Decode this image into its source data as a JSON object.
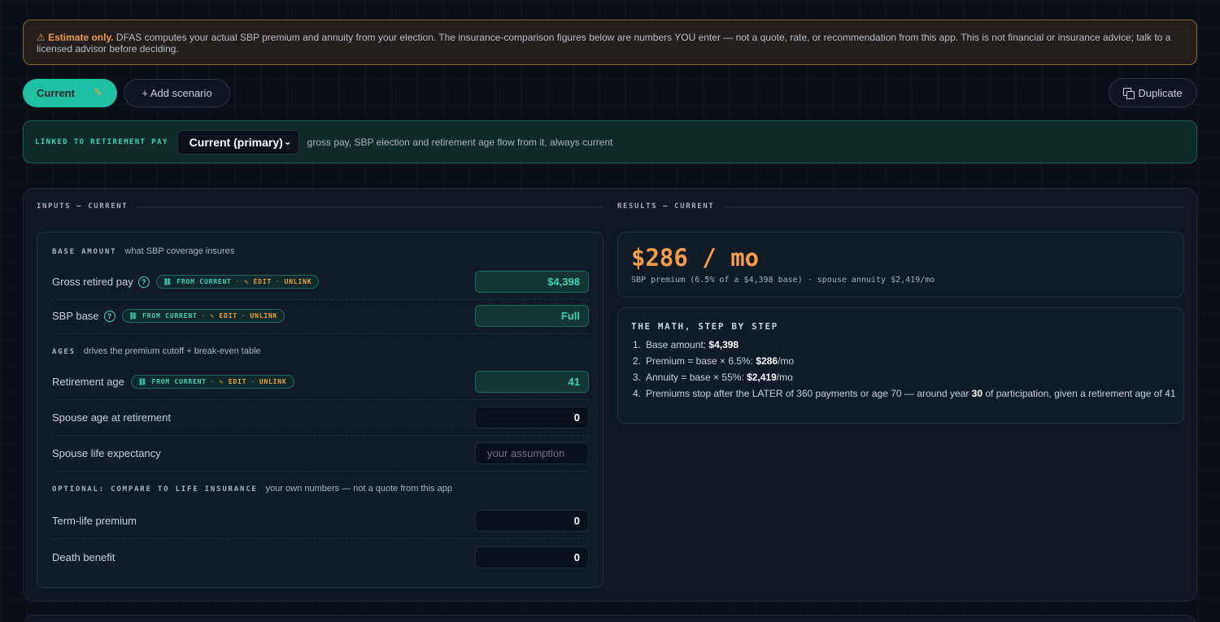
{
  "disclaimer": {
    "warn_label": "⚠ Estimate only.",
    "text": "DFAS computes your actual SBP premium and annuity from your election. The insurance-comparison figures below are numbers YOU enter — not a quote, rate, or recommendation from this app. This is not financial or insurance advice; talk to a licensed advisor before deciding."
  },
  "tabs": {
    "current_label": "Current",
    "current_edit_icon": "pencil-icon",
    "add_label": "+ Add scenario",
    "duplicate_label": "Duplicate",
    "duplicate_icon": "duplicate-icon"
  },
  "linked": {
    "label": "LINKED TO RETIREMENT PAY",
    "select_value": "Current (primary)",
    "description": "gross pay, SBP election and retirement age flow from it, always current"
  },
  "inputs": {
    "heading": "INPUTS — CURRENT",
    "base_group": {
      "title": "BASE AMOUNT",
      "subtitle": "what SBP coverage insures"
    },
    "ages_group": {
      "title": "AGES",
      "subtitle": "drives the premium cutoff + break-even table"
    },
    "optional_group": {
      "title": "OPTIONAL: COMPARE TO LIFE INSURANCE",
      "subtitle": "your own numbers — not a quote from this app"
    },
    "pill": {
      "from": "⛓ FROM CURRENT",
      "sep": "·",
      "edit": "✎ EDIT",
      "unlink": "UNLINK"
    },
    "gross_pay": {
      "label": "Gross retired pay",
      "value": "$4,398"
    },
    "sbp_base": {
      "label": "SBP base",
      "value": "Full"
    },
    "retirement_age": {
      "label": "Retirement age",
      "value": "41"
    },
    "spouse_age": {
      "label": "Spouse age at retirement",
      "value": "0"
    },
    "spouse_life": {
      "label": "Spouse life expectancy",
      "placeholder": "your assumption"
    },
    "term_premium": {
      "label": "Term-life premium",
      "value": "0"
    },
    "death_benefit": {
      "label": "Death benefit",
      "value": "0"
    }
  },
  "results": {
    "heading": "RESULTS — CURRENT",
    "big": "$286 / mo",
    "sub": "SBP premium (6.5% of a $4,398 base) · spouse annuity $2,419/mo",
    "math_title": "THE MATH, STEP BY STEP",
    "steps": [
      {
        "num": "1.",
        "pre": "Base amount: ",
        "bold": "$4,398",
        "post": ""
      },
      {
        "num": "2.",
        "pre": "Premium = base × 6.5%: ",
        "bold": "$286",
        "post": "/mo"
      },
      {
        "num": "3.",
        "pre": "Annuity = base × 55%: ",
        "bold": "$2,419",
        "post": "/mo"
      },
      {
        "num": "4.",
        "pre": "Premiums stop after the LATER of 360 payments or age 70 — around year ",
        "bold": "30",
        "post": " of participation, given a retirement age of 41"
      }
    ]
  },
  "colors": {
    "accent": "#1fbfa3",
    "warning": "#f19b4d",
    "result": "#f59c4e",
    "background": "#0a0f17"
  }
}
